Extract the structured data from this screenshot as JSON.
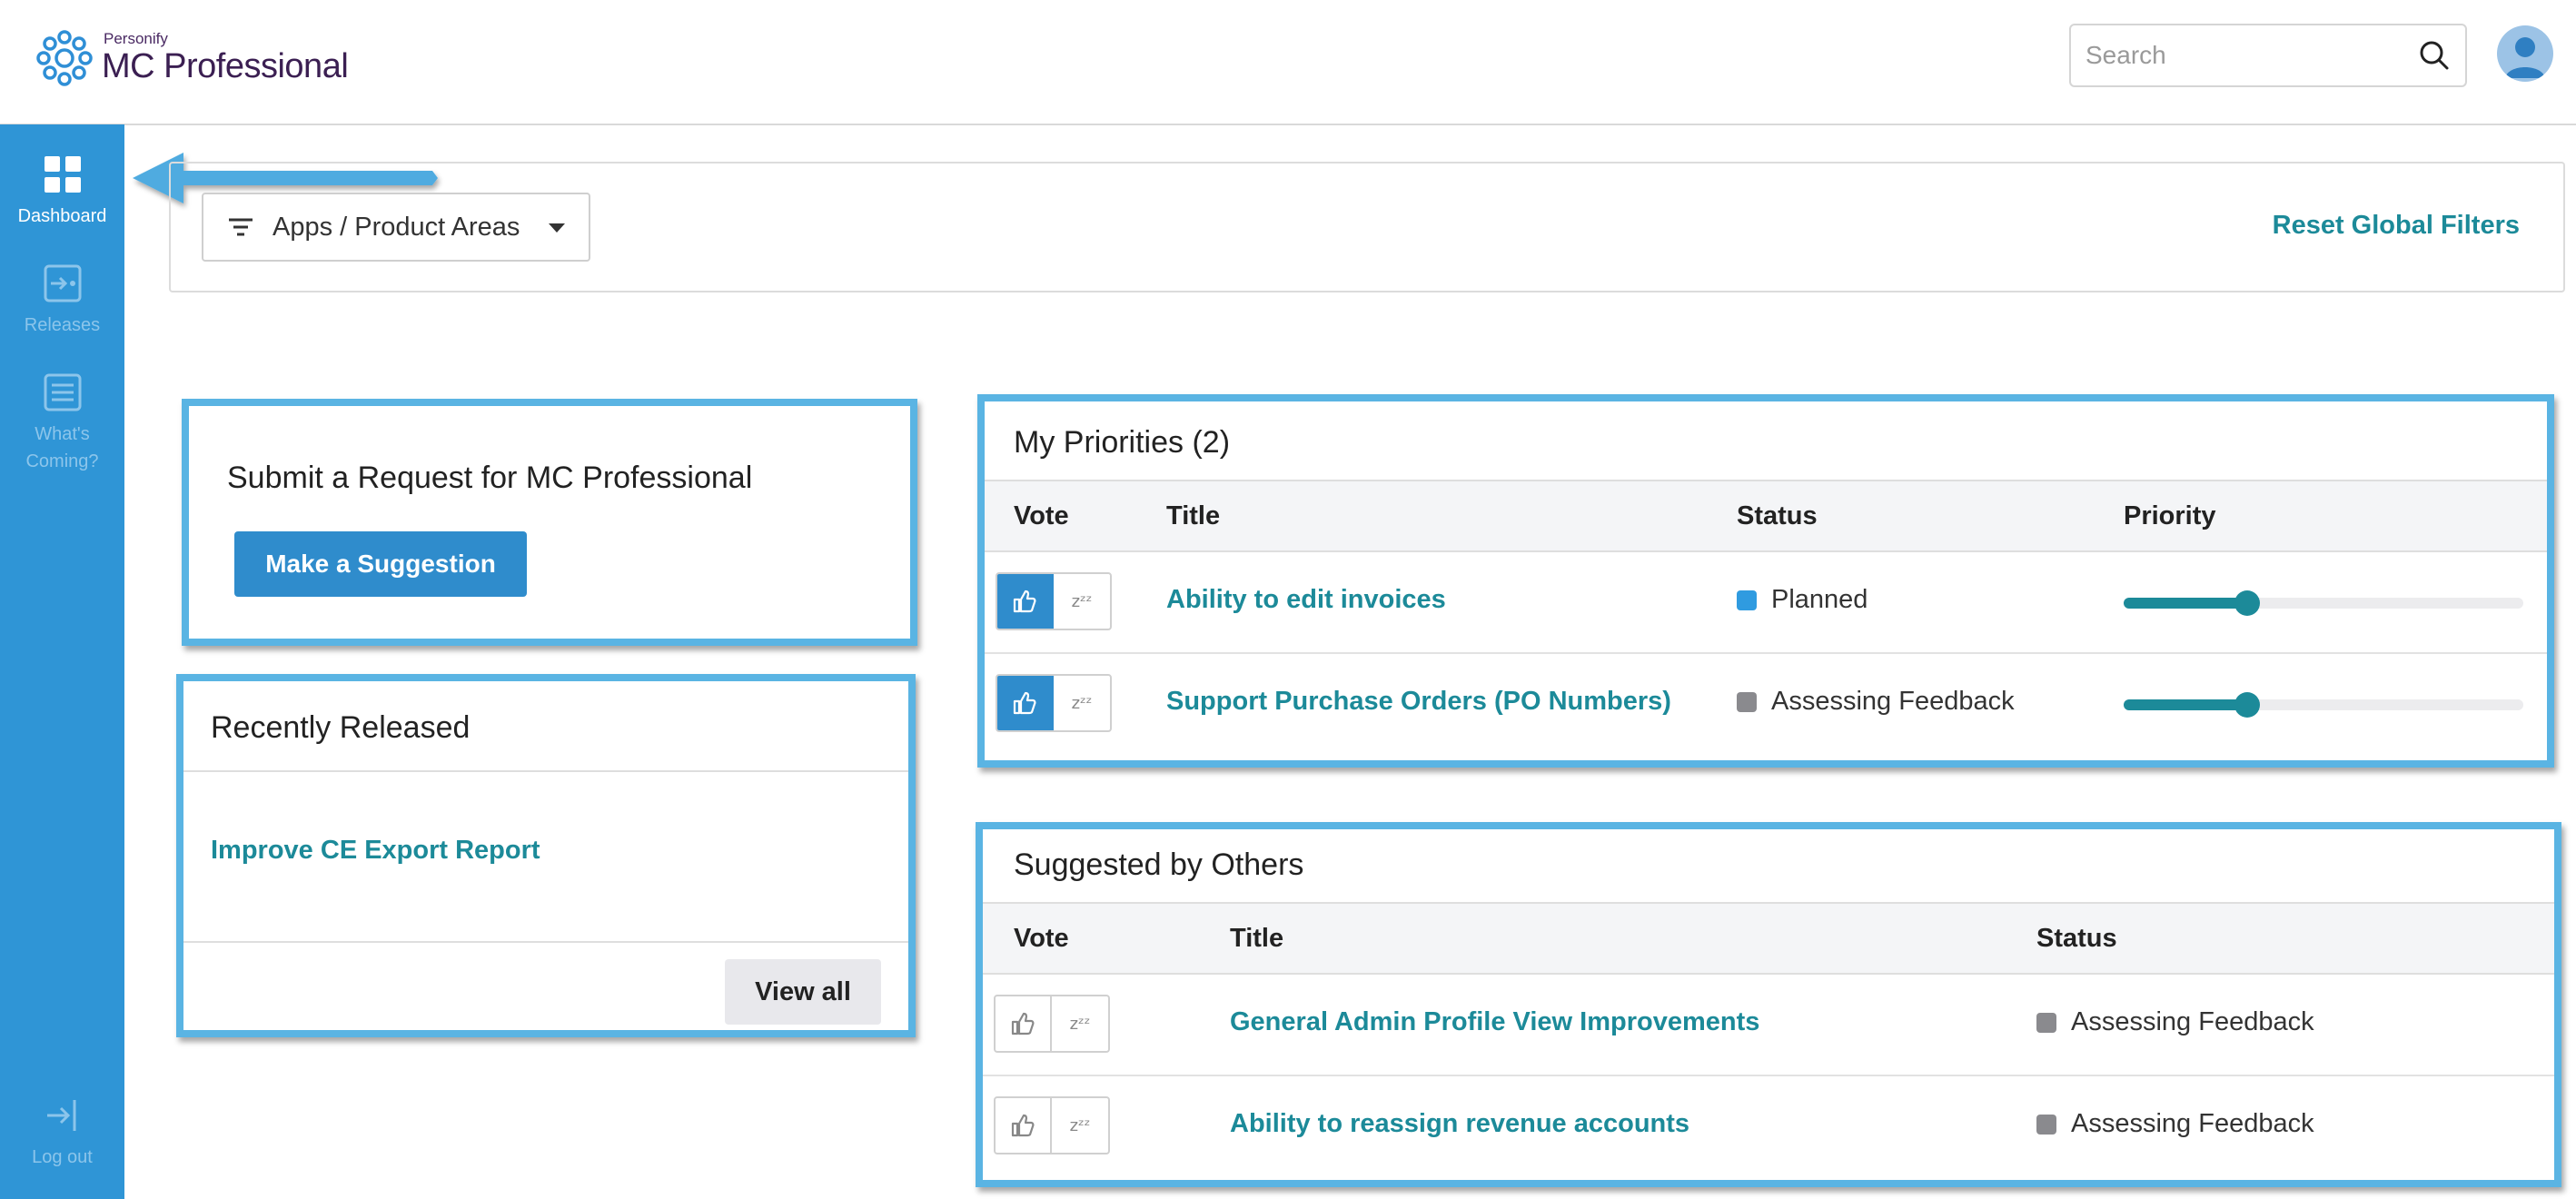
{
  "brand": {
    "company": "Personify",
    "product": "MC Professional"
  },
  "header": {
    "search_placeholder": "Search"
  },
  "sidebar": {
    "items": [
      {
        "label": "Dashboard",
        "icon": "dashboard-grid-icon",
        "active": true
      },
      {
        "label": "Releases",
        "icon": "releases-icon",
        "active": false
      },
      {
        "label": "What's Coming?",
        "icon": "list-icon",
        "active": false
      }
    ],
    "logout_label": "Log out"
  },
  "filters": {
    "apps_label": "Apps / Product Areas",
    "reset_label": "Reset Global Filters"
  },
  "submit_card": {
    "title": "Submit a Request for MC Professional",
    "button_label": "Make a Suggestion"
  },
  "recently_released": {
    "title": "Recently Released",
    "items": [
      "Improve CE Export Report"
    ],
    "view_all_label": "View all"
  },
  "my_priorities": {
    "title": "My Priorities (2)",
    "columns": [
      "Vote",
      "Title",
      "Status",
      "Priority"
    ],
    "rows": [
      {
        "title": "Ability to edit invoices",
        "status": "Planned",
        "status_color": "#2f9be0",
        "voted": true,
        "priority": 0.31
      },
      {
        "title": "Support Purchase Orders (PO Numbers)",
        "status": "Assessing Feedback",
        "status_color": "#8a8a8e",
        "voted": true,
        "priority": 0.31
      }
    ]
  },
  "suggested_by_others": {
    "title": "Suggested by Others",
    "columns": [
      "Vote",
      "Title",
      "Status"
    ],
    "rows": [
      {
        "title": "General Admin Profile View Improvements",
        "status": "Assessing Feedback",
        "status_color": "#8a8a8e",
        "voted": false
      },
      {
        "title": "Ability to reassign revenue accounts",
        "status": "Assessing Feedback",
        "status_color": "#8a8a8e",
        "voted": false
      }
    ]
  },
  "vote": {
    "snooze_glyph": "zᶻᶻ"
  },
  "colors": {
    "accent": "#2f95d6",
    "link": "#1c8a99",
    "highlight": "#5ab4e3"
  }
}
